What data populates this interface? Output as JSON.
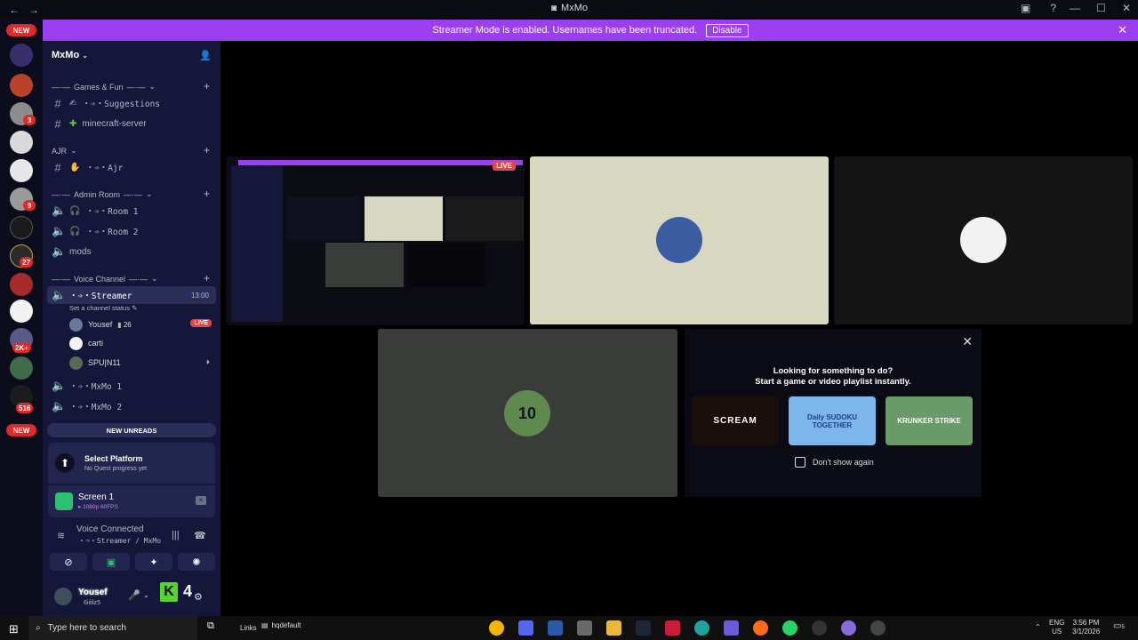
{
  "titlebar": {
    "back": "←",
    "forward": "→",
    "title": "MxMo"
  },
  "banner": {
    "message": "Streamer Mode is enabled. Usernames have been truncated.",
    "disable_label": "Disable"
  },
  "rail": {
    "new_top": "NEW",
    "new_bottom": "NEW",
    "badges": [
      "3",
      "9",
      "27",
      "2K+",
      "516"
    ]
  },
  "sidebar": {
    "guild_name": "MxMo",
    "categories": [
      {
        "label": "Games & Fun"
      },
      {
        "label": "AJR"
      },
      {
        "label": "Admin Room"
      },
      {
        "label": "Voice Channel"
      }
    ],
    "channels": {
      "suggestions": "・➩・Suggestions",
      "minecraft": "minecraft-server",
      "ajr": "・➩・Ajr",
      "room1": "・➩・Room 1",
      "room2": "・➩・Room 2",
      "mods": "mods",
      "streamer": "・➩・Streamer",
      "mxmo1": "・➩・MxMo 1",
      "mxmo2": "・➩・MxMo 2"
    },
    "streamer_time": "13:00",
    "channel_status": "Set a channel status",
    "voice_users": [
      {
        "name": "Yousef",
        "level": "26",
        "live": "LIVE"
      },
      {
        "name": "carti"
      },
      {
        "name": "SPU|N11"
      }
    ],
    "new_unreads": "NEW UNREADS"
  },
  "quest": {
    "title": "Select Platform",
    "subtitle": "No Quest progress yet"
  },
  "screen_share": {
    "title": "Screen 1",
    "quality": "1080p 60FPS"
  },
  "voice_connected": {
    "title": "Voice Connected",
    "channel": "・➩・Streamer / MxMo"
  },
  "user": {
    "name": "Yousef",
    "tag": "6iiiilz5",
    "badge_letter": "K",
    "number": "4"
  },
  "stage": {
    "live": "LIVE",
    "activity_line1": "Looking for something to do?",
    "activity_line2": "Start a game or video playlist instantly.",
    "dont_show": "Don't show again",
    "games": [
      "SCREAM",
      "Daily SUDOKU TOGETHER",
      "KRUNKER STRIKE"
    ],
    "jersey": "10"
  },
  "taskbar": {
    "search_placeholder": "Type here to search",
    "links": "Links",
    "hq": "hqdefault",
    "lang1": "ENG",
    "lang2": "US",
    "time": "3:56 PM",
    "date": "3/1/2026",
    "notif_count": "5"
  },
  "colors": {
    "banner": "#9b3ff0",
    "sidebar": "#15173a",
    "rail": "#0c0d1c",
    "live": "#ed4245",
    "accent_green": "#55d42c"
  }
}
